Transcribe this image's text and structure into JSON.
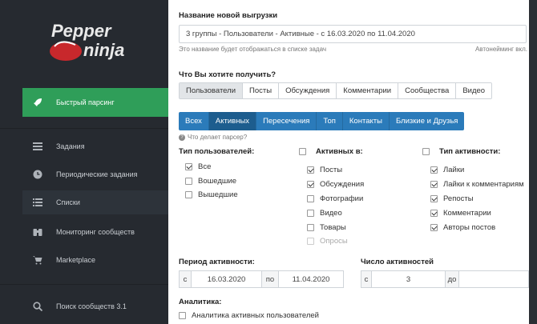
{
  "sidebar": {
    "logo_line1": "Pepper",
    "logo_line2": "ninja",
    "items": [
      {
        "label": "Быстрый парсинг",
        "icon": "rocket-icon"
      },
      {
        "label": "Задания",
        "icon": "tasks-icon"
      },
      {
        "label": "Периодические задания",
        "icon": "clock-icon"
      },
      {
        "label": "Списки",
        "icon": "list-icon"
      },
      {
        "label": "Мониторинг сообществ",
        "icon": "binoculars-icon"
      },
      {
        "label": "Marketplace",
        "icon": "cart-icon"
      },
      {
        "label": "Поиск сообществ 3.1",
        "icon": "search-icon"
      }
    ]
  },
  "form": {
    "name_label": "Название новой выгрузки",
    "name_value": "3 группы - Пользователи - Активные - с 16.03.2020 по 11.04.2020",
    "name_hint": "Это название будет отображаться в списке задач",
    "autoname": "Автонейминг вкл.",
    "what_label": "Что Вы хотите получить?",
    "what_tabs": [
      "Пользователи",
      "Посты",
      "Обсуждения",
      "Комментарии",
      "Сообщества",
      "Видео"
    ],
    "what_active": 0,
    "sub_tabs": [
      "Всех",
      "Активных",
      "Пересечения",
      "Топ",
      "Контакты",
      "Близкие и Друзья"
    ],
    "sub_active": 1,
    "parser_hint": "Что делает парсер?",
    "user_type_label": "Тип пользователей:",
    "user_types": [
      {
        "label": "Все",
        "checked": true
      },
      {
        "label": "Вошедшие",
        "checked": false
      },
      {
        "label": "Вышедшие",
        "checked": false
      }
    ],
    "active_in_label": "Активных в:",
    "active_in": [
      {
        "label": "Посты",
        "checked": true
      },
      {
        "label": "Обсуждения",
        "checked": true
      },
      {
        "label": "Фотографии",
        "checked": false
      },
      {
        "label": "Видео",
        "checked": false
      },
      {
        "label": "Товары",
        "checked": false
      },
      {
        "label": "Опросы",
        "checked": false,
        "disabled": true
      }
    ],
    "activity_type_label": "Тип активности:",
    "activity_types": [
      {
        "label": "Лайки",
        "checked": true
      },
      {
        "label": "Лайки к комментариям",
        "checked": true
      },
      {
        "label": "Репосты",
        "checked": true
      },
      {
        "label": "Комментарии",
        "checked": true
      },
      {
        "label": "Авторы постов",
        "checked": true
      }
    ],
    "period_label": "Период активности:",
    "period_from_prefix": "с",
    "period_from": "16.03.2020",
    "period_to_prefix": "по",
    "period_to": "11.04.2020",
    "count_label": "Число активностей",
    "count_from_prefix": "с",
    "count_from": "3",
    "count_to_prefix": "до",
    "count_to": "",
    "analytics_label": "Аналитика:",
    "analytics_option": "Аналитика активных пользователей"
  }
}
